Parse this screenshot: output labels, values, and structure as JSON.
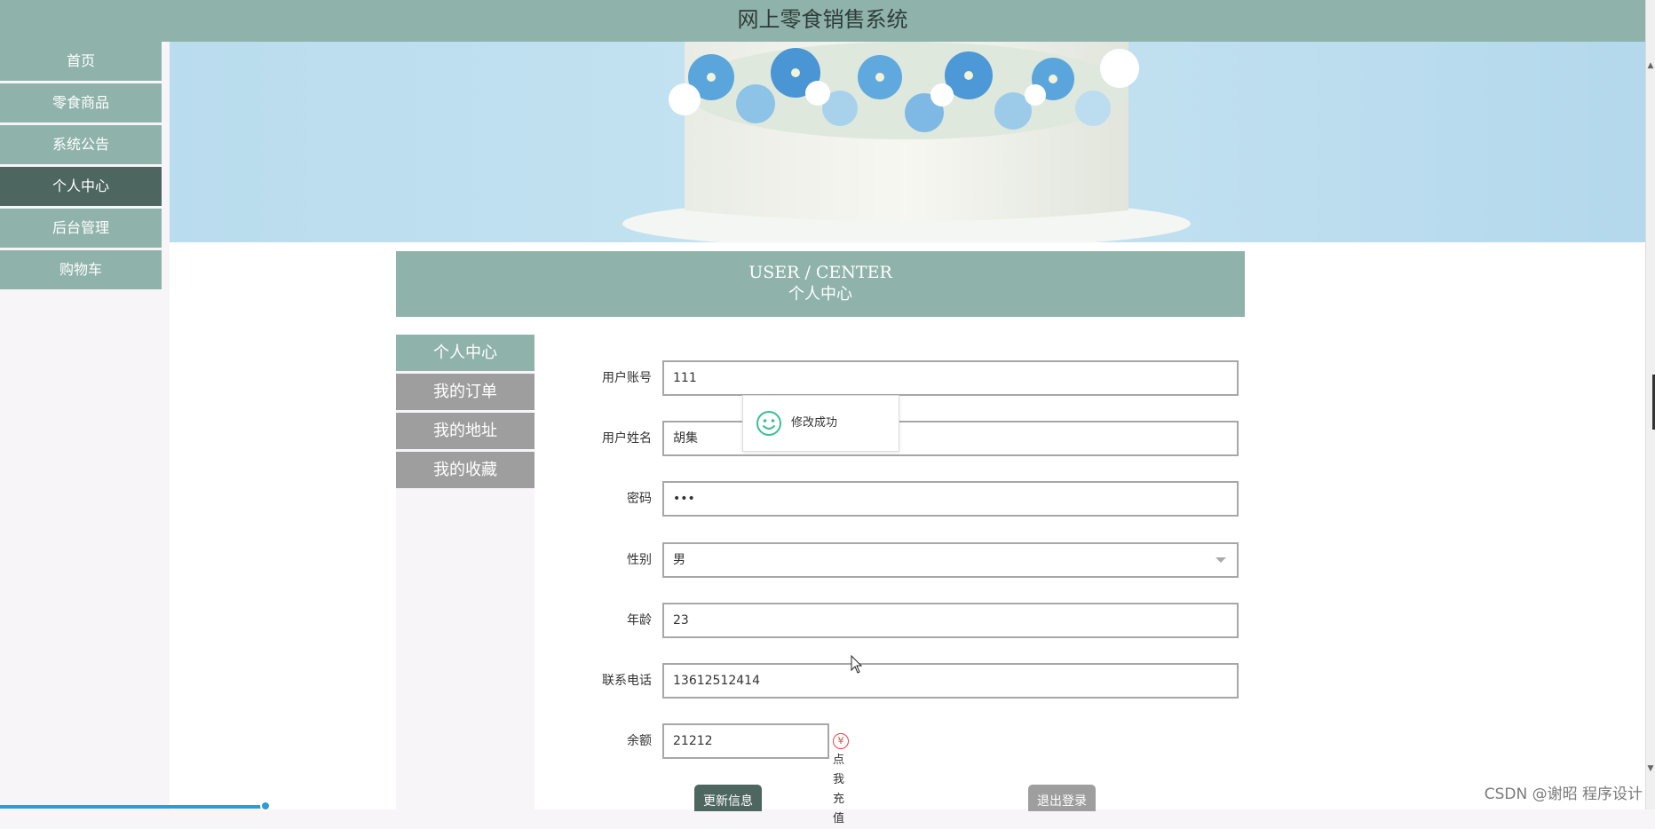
{
  "app": {
    "title": "网上零食销售系统"
  },
  "nav": {
    "items": [
      {
        "label": "首页"
      },
      {
        "label": "零食商品"
      },
      {
        "label": "系统公告"
      },
      {
        "label": "个人中心",
        "active": true
      },
      {
        "label": "后台管理"
      },
      {
        "label": "购物车"
      }
    ]
  },
  "section": {
    "title_en": "USER / CENTER",
    "title_cn": "个人中心"
  },
  "subnav": {
    "items": [
      {
        "label": "个人中心",
        "active": true
      },
      {
        "label": "我的订单"
      },
      {
        "label": "我的地址"
      },
      {
        "label": "我的收藏"
      }
    ]
  },
  "form": {
    "username": {
      "label": "用户账号",
      "value": "111"
    },
    "name": {
      "label": "用户姓名",
      "value": "胡集"
    },
    "password": {
      "label": "密码",
      "value": "•••"
    },
    "gender": {
      "label": "性别",
      "value": "男"
    },
    "age": {
      "label": "年龄",
      "value": "23"
    },
    "phone": {
      "label": "联系电话",
      "value": "13612512414"
    },
    "balance": {
      "label": "余额",
      "value": "21212",
      "recharge_label": "点我充值"
    }
  },
  "buttons": {
    "update": "更新信息",
    "logout": "退出登录"
  },
  "toast": {
    "message": "修改成功"
  },
  "watermark": "CSDN @谢昭  程序设计",
  "colors": {
    "primary": "#8fb3ab",
    "active": "#4d6760",
    "sub_inactive": "#9e9e9e",
    "toast_icon": "#3bbf8f",
    "recharge": "#e64545"
  }
}
